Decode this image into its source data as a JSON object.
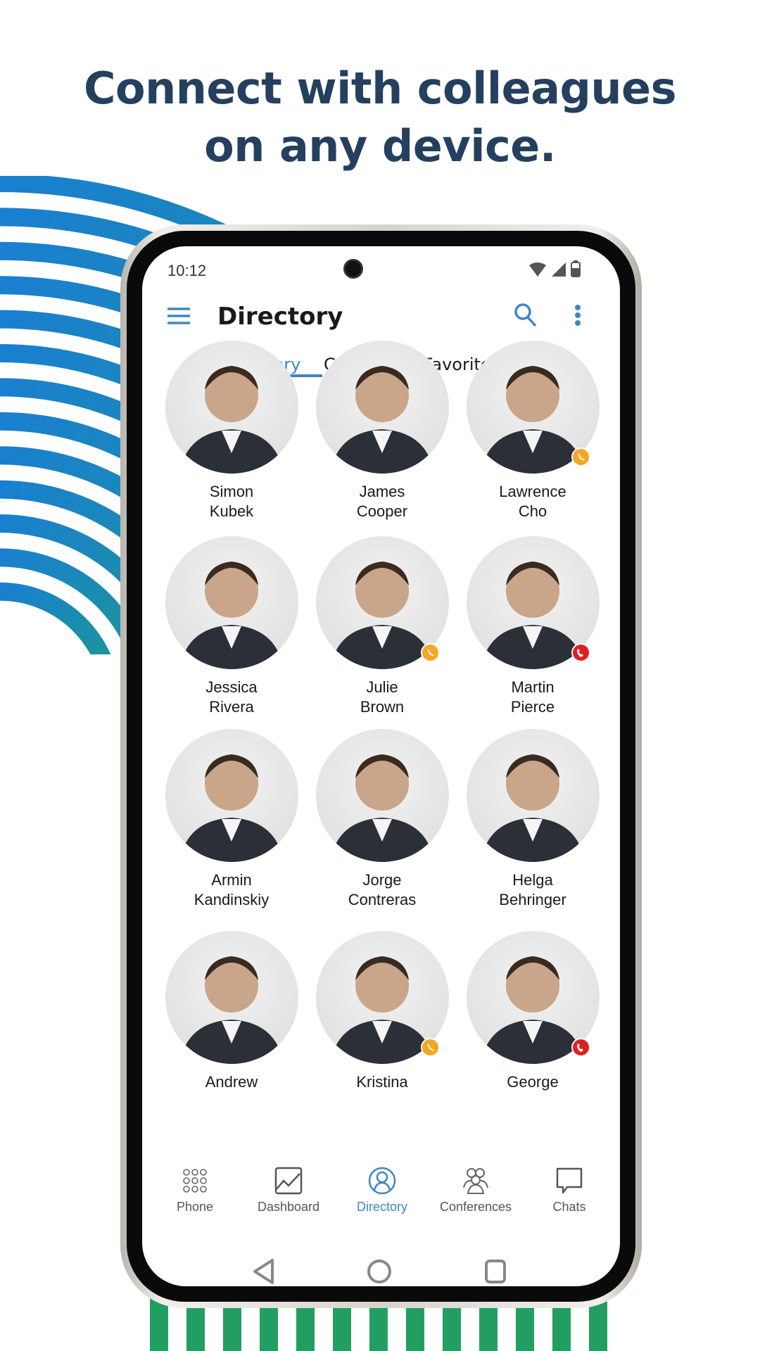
{
  "headline": {
    "line1": "Connect with colleagues",
    "line2": "on any device."
  },
  "colors": {
    "accent": "#3d86c6",
    "headline": "#25405e",
    "away": "#f5a623",
    "busy": "#e02020",
    "stripes_green": "#239e62",
    "arcs_blue": "#1a7fd0",
    "arcs_teal": "#1a9b8a"
  },
  "status_bar": {
    "time": "10:12",
    "icons": [
      "wifi-icon",
      "signal-icon",
      "battery-icon"
    ]
  },
  "app_bar": {
    "title": "Directory",
    "menu_icon": "hamburger-icon",
    "search_icon": "search-icon",
    "more_icon": "more-vertical-icon"
  },
  "tabs": [
    {
      "label": "Directory",
      "active": true
    },
    {
      "label": "Contacts",
      "active": false
    },
    {
      "label": "Favorites",
      "active": false
    }
  ],
  "contacts": [
    {
      "first": "Simon",
      "last": "Kubek",
      "status": ""
    },
    {
      "first": "James",
      "last": "Cooper",
      "status": ""
    },
    {
      "first": "Lawrence",
      "last": "Cho",
      "status": "away"
    },
    {
      "first": "Jessica",
      "last": "Rivera",
      "status": ""
    },
    {
      "first": "Julie",
      "last": "Brown",
      "status": "away"
    },
    {
      "first": "Martin",
      "last": "Pierce",
      "status": "busy"
    },
    {
      "first": "Armin",
      "last": "Kandinskiy",
      "status": ""
    },
    {
      "first": "Jorge",
      "last": "Contreras",
      "status": ""
    },
    {
      "first": "Helga",
      "last": "Behringer",
      "status": ""
    },
    {
      "first": "Andrew",
      "last": "",
      "status": ""
    },
    {
      "first": "Kristina",
      "last": "",
      "status": "away"
    },
    {
      "first": "George",
      "last": "",
      "status": "busy"
    }
  ],
  "bottom_nav": [
    {
      "label": "Phone",
      "icon": "dialpad-icon",
      "active": false
    },
    {
      "label": "Dashboard",
      "icon": "chart-icon",
      "active": false
    },
    {
      "label": "Directory",
      "icon": "person-icon",
      "active": true
    },
    {
      "label": "Conferences",
      "icon": "group-icon",
      "active": false
    },
    {
      "label": "Chats",
      "icon": "chat-icon",
      "active": false
    }
  ],
  "system_nav": [
    "back-icon",
    "home-icon",
    "recents-icon"
  ]
}
